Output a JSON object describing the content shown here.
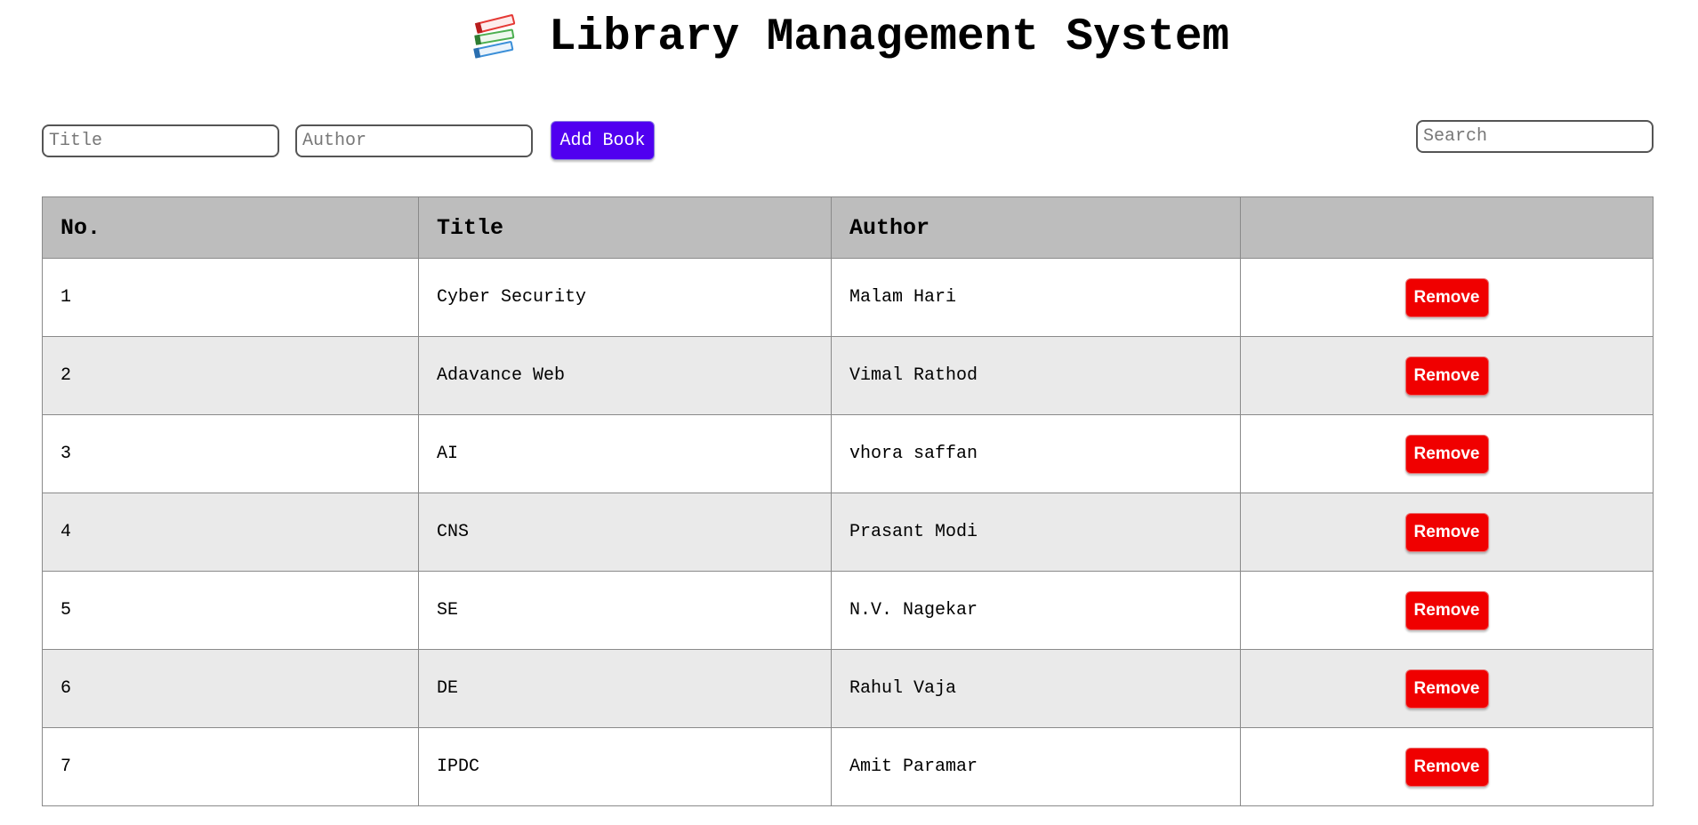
{
  "header": {
    "icon": "books-icon",
    "title": "Library Management System"
  },
  "form": {
    "title_placeholder": "Title",
    "title_value": "",
    "author_placeholder": "Author",
    "author_value": "",
    "add_label": "Add Book"
  },
  "search": {
    "placeholder": "Search",
    "value": ""
  },
  "table": {
    "columns": [
      "No.",
      "Title",
      "Author",
      ""
    ],
    "rows": [
      {
        "no": "1",
        "title": "Cyber Security",
        "author": "Malam Hari",
        "action": "Remove"
      },
      {
        "no": "2",
        "title": "Adavance Web",
        "author": "Vimal Rathod",
        "action": "Remove"
      },
      {
        "no": "3",
        "title": "AI",
        "author": "vhora saffan",
        "action": "Remove"
      },
      {
        "no": "4",
        "title": "CNS",
        "author": "Prasant Modi",
        "action": "Remove"
      },
      {
        "no": "5",
        "title": "SE",
        "author": "N.V. Nagekar",
        "action": "Remove"
      },
      {
        "no": "6",
        "title": "DE",
        "author": "Rahul Vaja",
        "action": "Remove"
      },
      {
        "no": "7",
        "title": "IPDC",
        "author": "Amit Paramar",
        "action": "Remove"
      }
    ]
  },
  "colors": {
    "add_button": "#5000f0",
    "remove_button": "#f00000",
    "header_row": "#bdbdbd",
    "alt_row": "#eaeaea"
  }
}
